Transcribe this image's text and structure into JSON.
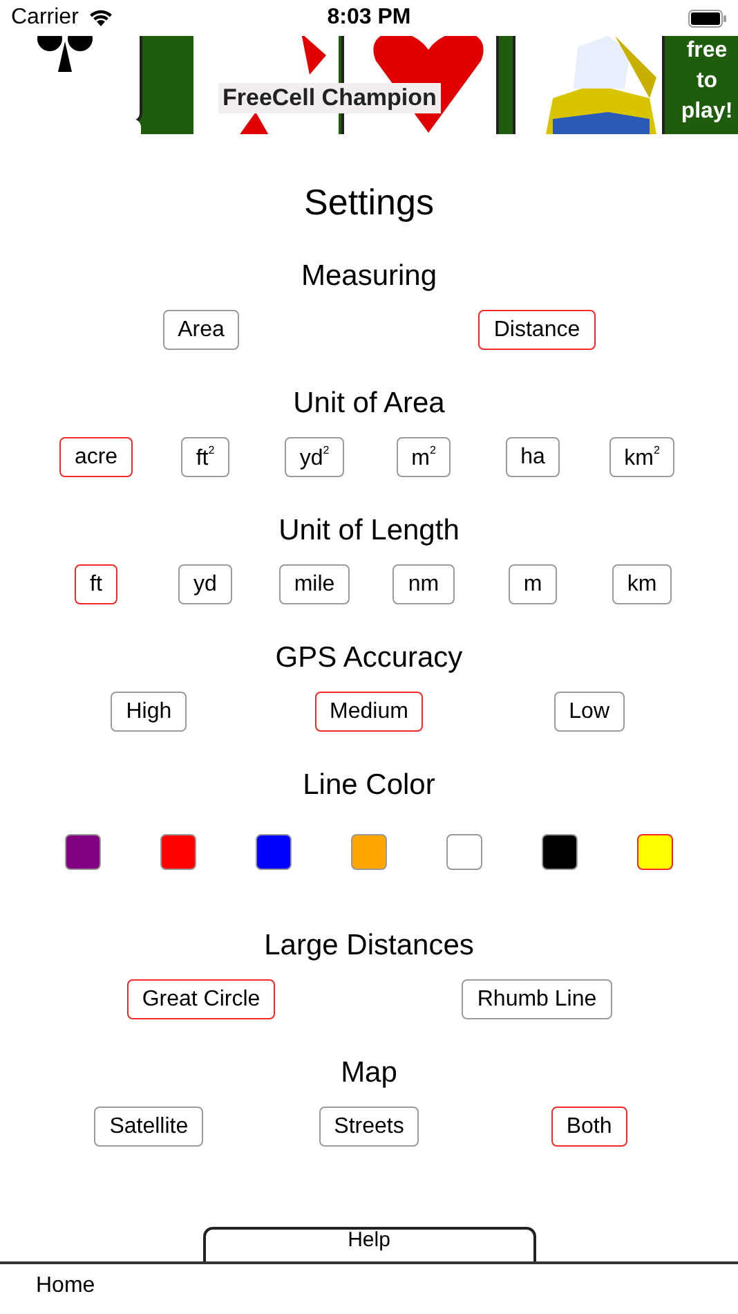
{
  "status_bar": {
    "carrier": "Carrier",
    "time": "8:03 PM"
  },
  "ad_banner": {
    "headline": "FreeCell Champion",
    "tagline": "free to play!"
  },
  "title": "Settings",
  "sections": [
    {
      "kind": "options",
      "heading": "Measuring",
      "options": [
        {
          "label": "Area",
          "selected": false
        },
        {
          "label": "Distance",
          "selected": true
        }
      ]
    },
    {
      "kind": "options",
      "heading": "Unit of Area",
      "options": [
        {
          "label": "acre",
          "selected": true
        },
        {
          "label": "ft$^{2}$",
          "selected": false
        },
        {
          "label": "yd$^{2}$",
          "selected": false
        },
        {
          "label": "m$^{2}$",
          "selected": false
        },
        {
          "label": "ha",
          "selected": false
        },
        {
          "label": "km$^{2}$",
          "selected": false
        }
      ]
    },
    {
      "kind": "options",
      "heading": "Unit of Length",
      "options": [
        {
          "label": "ft",
          "selected": true
        },
        {
          "label": "yd",
          "selected": false
        },
        {
          "label": "mile",
          "selected": false
        },
        {
          "label": "nm",
          "selected": false
        },
        {
          "label": "m",
          "selected": false
        },
        {
          "label": "km",
          "selected": false
        }
      ]
    },
    {
      "kind": "options",
      "heading": "GPS Accuracy",
      "options": [
        {
          "label": "High",
          "selected": false
        },
        {
          "label": "Medium",
          "selected": true
        },
        {
          "label": "Low",
          "selected": false
        }
      ]
    },
    {
      "kind": "colors",
      "heading": "Line Color",
      "swatches": [
        {
          "color": "#800080",
          "selected": false
        },
        {
          "color": "#ff0000",
          "selected": false
        },
        {
          "color": "#0000ff",
          "selected": false
        },
        {
          "color": "#ffa500",
          "selected": false
        },
        {
          "color": "#ffffff",
          "selected": false
        },
        {
          "color": "#000000",
          "selected": false
        },
        {
          "color": "#ffff00",
          "selected": true
        }
      ]
    },
    {
      "kind": "options",
      "heading": "Large Distances",
      "options": [
        {
          "label": "Great Circle",
          "selected": true
        },
        {
          "label": "Rhumb Line",
          "selected": false
        }
      ]
    },
    {
      "kind": "options",
      "heading": "Map",
      "options": [
        {
          "label": "Satellite",
          "selected": false
        },
        {
          "label": "Streets",
          "selected": false
        },
        {
          "label": "Both",
          "selected": true
        }
      ]
    }
  ],
  "help_button": "Help",
  "tab_bar": [
    {
      "label": "Home"
    }
  ]
}
